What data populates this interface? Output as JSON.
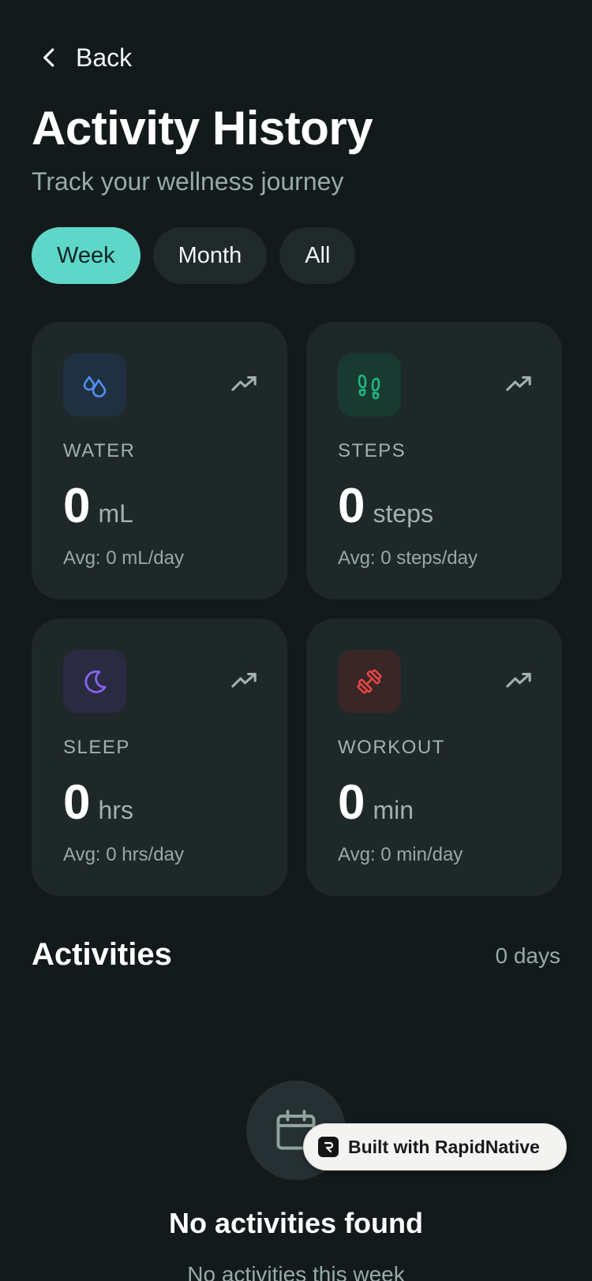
{
  "header": {
    "back_label": "Back",
    "title": "Activity History",
    "subtitle": "Track your wellness journey"
  },
  "filters": {
    "options": [
      "Week",
      "Month",
      "All"
    ],
    "selected": "Week"
  },
  "stats": [
    {
      "icon": "water-drops-icon",
      "label": "WATER",
      "value": "0",
      "unit": "mL",
      "avg": "Avg: 0 mL/day",
      "color": "#4e8ff2",
      "tile": "#1f3040"
    },
    {
      "icon": "footprints-icon",
      "label": "STEPS",
      "value": "0",
      "unit": "steps",
      "avg": "Avg: 0 steps/day",
      "color": "#1fb882",
      "tile": "#193a30"
    },
    {
      "icon": "moon-icon",
      "label": "SLEEP",
      "value": "0",
      "unit": "hrs",
      "avg": "Avg: 0 hrs/day",
      "color": "#8a63f0",
      "tile": "#2a2b42"
    },
    {
      "icon": "dumbbell-icon",
      "label": "WORKOUT",
      "value": "0",
      "unit": "min",
      "avg": "Avg: 0 min/day",
      "color": "#e34545",
      "tile": "#3a2627"
    }
  ],
  "activities": {
    "title": "Activities",
    "count": "0 days",
    "empty_title": "No activities found",
    "empty_subtitle": "No activities this week"
  },
  "badge": {
    "text": "Built with RapidNative"
  },
  "colors": {
    "background": "#121a1b",
    "card": "#1f2829",
    "accent": "#5fd7c8"
  }
}
